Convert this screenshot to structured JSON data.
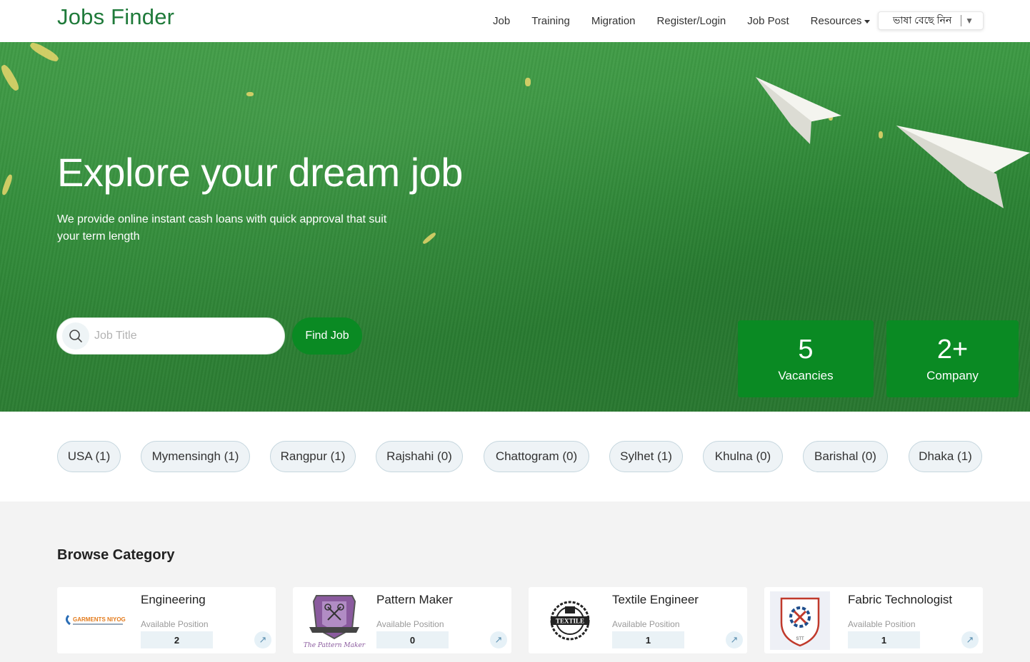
{
  "navbar": {
    "brand": "Jobs Finder",
    "links": [
      "Job",
      "Training",
      "Migration",
      "Register/Login",
      "Job Post"
    ],
    "resources": "Resources",
    "language_select": "ভাষা বেছে নিন"
  },
  "hero": {
    "title": "Explore your dream job",
    "subtitle": "We provide online instant cash loans with quick approval that suit your term length",
    "search_placeholder": "Job Title",
    "find_button": "Find Job",
    "stats": [
      {
        "value": "5",
        "label": "Vacancies"
      },
      {
        "value": "2+",
        "label": "Company"
      }
    ]
  },
  "locations": [
    "USA (1)",
    "Mymensingh (1)",
    "Rangpur (1)",
    "Rajshahi (0)",
    "Chattogram (0)",
    "Sylhet (1)",
    "Khulna (0)",
    "Barishal (0)",
    "Dhaka (1)"
  ],
  "browse": {
    "title": "Browse Category",
    "available_label": "Available Position",
    "categories": [
      {
        "name": "Engineering",
        "count": "2",
        "logo": "garments-niyog-logo",
        "logo_text": "GARMENTS NIYOG"
      },
      {
        "name": "Pattern Maker",
        "count": "0",
        "logo": "pattern-maker-badge-logo",
        "logo_text": "The Pattern Maker"
      },
      {
        "name": "Textile Engineer",
        "count": "1",
        "logo": "textile-engineering-emblem",
        "logo_text": "TEXTILE"
      },
      {
        "name": "Fabric Technologist",
        "count": "1",
        "logo": "stt-shield-logo",
        "logo_text": "STT"
      }
    ]
  },
  "colors": {
    "brand": "#1f7a3a",
    "primary_button": "#0a8a23",
    "hero_green": "#2f8a38"
  }
}
